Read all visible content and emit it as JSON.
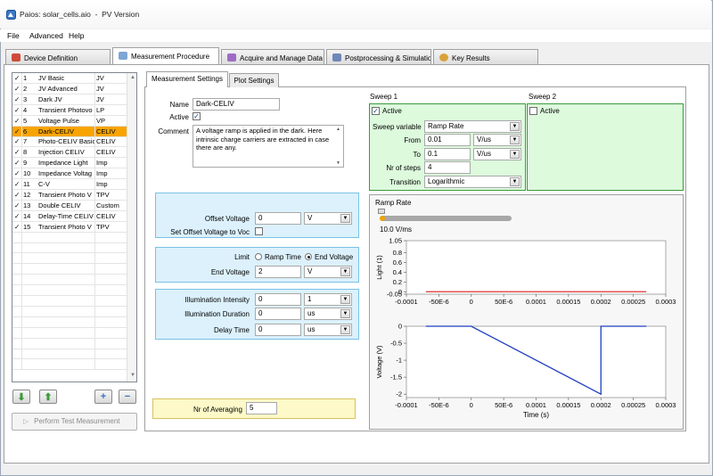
{
  "window": {
    "title": "Paios: solar_cells.aio  -  PV Version"
  },
  "menu": [
    "File",
    "Advanced",
    "Help"
  ],
  "main_tabs": [
    {
      "label": "Device Definition",
      "icon": "device-icon"
    },
    {
      "label": "Measurement Procedure",
      "icon": "procedure-icon",
      "selected": true
    },
    {
      "label": "Acquire and Manage Data",
      "icon": "acquire-icon"
    },
    {
      "label": "Postprocessing & Simulatio",
      "icon": "postprocessing-icon"
    },
    {
      "label": "Key Results",
      "icon": "key-results-icon"
    }
  ],
  "measurements": [
    {
      "num": "1",
      "name": "JV Basic",
      "type": "JV"
    },
    {
      "num": "2",
      "name": "JV Advanced",
      "type": "JV"
    },
    {
      "num": "3",
      "name": "Dark JV",
      "type": "JV"
    },
    {
      "num": "4",
      "name": "Transient Photovo",
      "type": "LP"
    },
    {
      "num": "5",
      "name": "Voltage Pulse",
      "type": "VP"
    },
    {
      "num": "6",
      "name": "Dark-CELIV",
      "type": "CELIV",
      "selected": true
    },
    {
      "num": "7",
      "name": "Photo-CELIV Basic",
      "type": "CELIV"
    },
    {
      "num": "8",
      "name": "Injection CELIV",
      "type": "CELIV"
    },
    {
      "num": "9",
      "name": "Impedance Light",
      "type": "Imp"
    },
    {
      "num": "10",
      "name": "Impedance Voltag",
      "type": "Imp"
    },
    {
      "num": "11",
      "name": "C-V",
      "type": "Imp"
    },
    {
      "num": "12",
      "name": "Transient Photo V",
      "type": "TPV"
    },
    {
      "num": "13",
      "name": "Double CELIV",
      "type": "Custom"
    },
    {
      "num": "14",
      "name": "Delay-Time CELIV",
      "type": "CELIV"
    },
    {
      "num": "15",
      "name": "Transient Photo V",
      "type": "TPV"
    }
  ],
  "list_controls": {
    "check": "✓",
    "test_button": "Perform Test Measurement"
  },
  "sub_tabs": [
    "Measurement Settings",
    "Plot Settings"
  ],
  "settings": {
    "name_label": "Name",
    "name_value": "Dark-CELIV",
    "active_label": "Active",
    "comment_label": "Comment",
    "comment_value": "A voltage ramp is applied in the dark. Here intrinsic charge carriers are extracted in case there are any.",
    "offset_voltage_label": "Offset Voltage",
    "offset_voltage_value": "0",
    "offset_voltage_unit": "V",
    "set_offset_label": "Set Offset Voltage to Voc",
    "limit_label": "Limit",
    "ramp_time_label": "Ramp Time",
    "end_voltage_radio_label": "End Voltage",
    "end_voltage_label": "End Voltage",
    "end_voltage_value": "2",
    "end_voltage_unit": "V",
    "illum_intensity_label": "Illumination Intensity",
    "illum_intensity_value": "0",
    "illum_intensity_unit": "1",
    "illum_duration_label": "Illumination Duration",
    "illum_duration_value": "0",
    "illum_duration_unit": "us",
    "delay_time_label": "Delay Time",
    "delay_time_value": "0",
    "delay_time_unit": "us",
    "averaging_label": "Nr of Averaging",
    "averaging_value": "5"
  },
  "sweep1": {
    "title": "Sweep 1",
    "active_label": "Active",
    "variable_label": "Sweep variable",
    "variable_value": "Ramp Rate",
    "from_label": "From",
    "from_value": "0.01",
    "from_unit": "V/us",
    "to_label": "To",
    "to_value": "0.1",
    "to_unit": "V/us",
    "steps_label": "Nr of steps",
    "steps_value": "4",
    "transition_label": "Transition",
    "transition_value": "Logarithmic"
  },
  "sweep2": {
    "title": "Sweep 2",
    "active_label": "Active"
  },
  "preview": {
    "ramp_label": "Ramp Rate",
    "ramp_value_label": "10.0 V/ms",
    "ramp_slider_fraction": 0.0
  },
  "chart_data": [
    {
      "type": "line",
      "ylabel": "Light (1)",
      "xlim": [
        -0.0001,
        0.0003
      ],
      "ylim": [
        -0.05,
        1.05
      ],
      "x_ticks": [
        "-0.0001",
        "-50E-6",
        "0",
        "50E-6",
        "0.0001",
        "0.00015",
        "0.0002",
        "0.00025",
        "0.0003"
      ],
      "y_ticks": [
        "1.05",
        "0.8",
        "0.6",
        "0.4",
        "0.2",
        "0",
        "-0.05"
      ],
      "series": [
        {
          "color": "#e03030",
          "x": [
            -7e-05,
            0.00027
          ],
          "y": [
            0,
            0
          ]
        }
      ]
    },
    {
      "type": "line",
      "xlabel": "Time (s)",
      "ylabel": "Voltage (V)",
      "xlim": [
        -0.0001,
        0.0003
      ],
      "ylim": [
        -2.1,
        0
      ],
      "x_ticks": [
        "-0.0001",
        "-50E-6",
        "0",
        "50E-6",
        "0.0001",
        "0.00015",
        "0.0002",
        "0.00025",
        "0.0003"
      ],
      "y_ticks": [
        "0",
        "-0.5",
        "-1",
        "-1.5",
        "-2"
      ],
      "series": [
        {
          "color": "#1f3fbf",
          "x": [
            -7e-05,
            0,
            0.0002,
            0.0002,
            0.00027
          ],
          "y": [
            0,
            0,
            -2,
            0,
            0
          ]
        }
      ]
    }
  ],
  "colors": {
    "selected_row": "#f8a400",
    "blue_box": "#dcf1fc",
    "green_box": "#ddfadd",
    "yellow_box": "#fdf9c8"
  }
}
